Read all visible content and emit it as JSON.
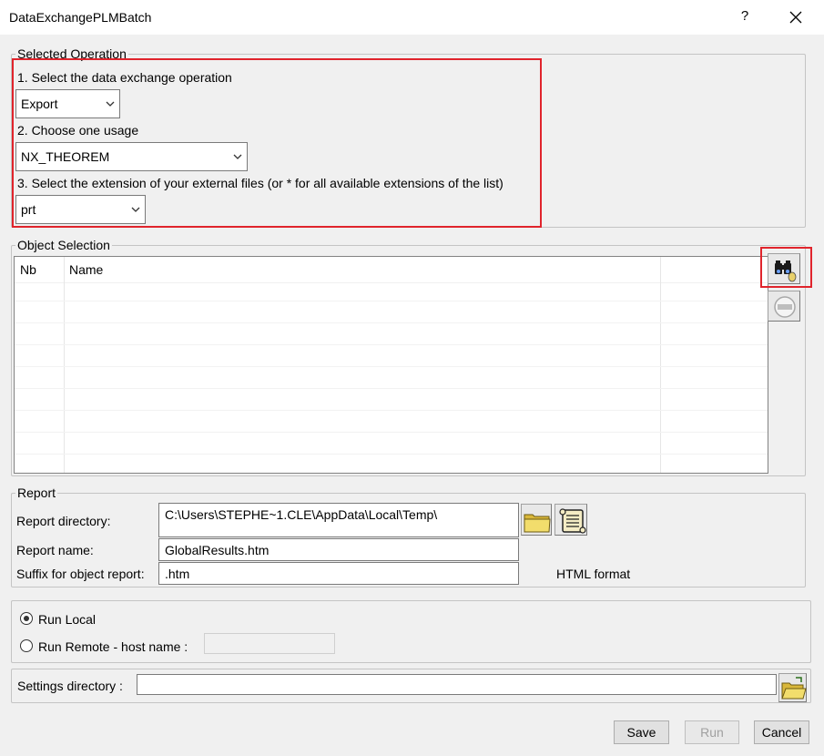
{
  "window": {
    "title": "DataExchangePLMBatch",
    "help_label": "?",
    "close_icon": "close-icon"
  },
  "selected_operation": {
    "legend": "Selected Operation",
    "step1_label": "1. Select the data exchange operation",
    "operation_value": "Export",
    "step2_label": "2. Choose one usage",
    "usage_value": "NX_THEOREM",
    "step3_label": "3. Select the extension of your external files (or * for all available extensions of the list)",
    "extension_value": "prt"
  },
  "object_selection": {
    "legend": "Object Selection",
    "columns": [
      "Nb",
      "Name",
      ""
    ],
    "rows": [],
    "search_button_icon": "binoculars-search-icon",
    "remove_button_icon": "remove-circle-icon"
  },
  "report": {
    "legend": "Report",
    "directory_label": "Report directory:",
    "directory_value": "C:\\Users\\STEPHE~1.CLE\\AppData\\Local\\Temp\\",
    "name_label": "Report name:",
    "name_value": "GlobalResults.htm",
    "suffix_label": "Suffix for object report:",
    "suffix_value": ".htm",
    "format_label": "HTML format",
    "browse_icon": "folder-icon",
    "view_icon": "scroll-icon"
  },
  "run": {
    "local_label": "Run Local",
    "local_selected": true,
    "remote_label": "Run Remote - host name :",
    "remote_selected": false,
    "host_value": ""
  },
  "settings": {
    "label": "Settings directory :",
    "value": "",
    "browse_icon": "open-folder-icon"
  },
  "buttons": {
    "save": "Save",
    "run": "Run",
    "cancel": "Cancel"
  },
  "colors": {
    "highlight": "#e0242c",
    "background": "#f0f0f0"
  }
}
